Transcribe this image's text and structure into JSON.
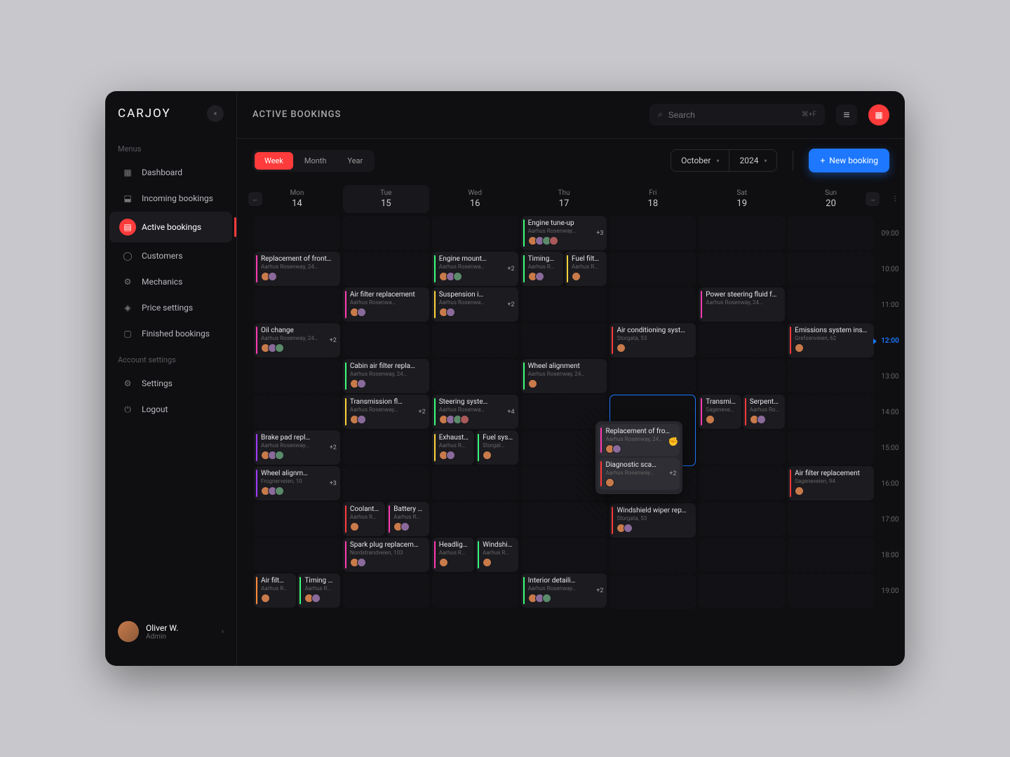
{
  "brand": "CARJOY",
  "page_title": "ACTIVE BOOKINGS",
  "search": {
    "placeholder": "Search",
    "shortcut": "⌘+F"
  },
  "sidebar": {
    "menus_label": "Menus",
    "account_label": "Account settings",
    "items": [
      {
        "label": "Dashboard",
        "icon": "grid"
      },
      {
        "label": "Incoming bookings",
        "icon": "inbox"
      },
      {
        "label": "Active bookings",
        "icon": "clipboard",
        "active": true
      },
      {
        "label": "Customers",
        "icon": "user"
      },
      {
        "label": "Mechanics",
        "icon": "wrench"
      },
      {
        "label": "Price settings",
        "icon": "tag"
      },
      {
        "label": "Finished bookings",
        "icon": "box"
      }
    ],
    "account_items": [
      {
        "label": "Settings",
        "icon": "gear"
      },
      {
        "label": "Logout",
        "icon": "power"
      }
    ]
  },
  "user": {
    "name": "Oliver W.",
    "role": "Admin"
  },
  "view_tabs": [
    "Week",
    "Month",
    "Year"
  ],
  "active_view": "Week",
  "month": "October",
  "year": "2024",
  "new_booking_label": "New booking",
  "days": [
    {
      "dow": "Mon",
      "num": "14"
    },
    {
      "dow": "Tue",
      "num": "15",
      "today": true
    },
    {
      "dow": "Wed",
      "num": "16"
    },
    {
      "dow": "Thu",
      "num": "17"
    },
    {
      "dow": "Fri",
      "num": "18"
    },
    {
      "dow": "Sat",
      "num": "19"
    },
    {
      "dow": "Sun",
      "num": "20"
    }
  ],
  "times": [
    "09:00",
    "10:00",
    "11:00",
    "12:00",
    "13:00",
    "14:00",
    "15:00",
    "16:00",
    "17:00",
    "18:00",
    "19:00"
  ],
  "now_time": "12:00",
  "colors": {
    "pink": "#ff3bb1",
    "green": "#3bff7a",
    "yellow": "#ffd23b",
    "red": "#ff3b3b",
    "purple": "#a23bff",
    "blue": "#3b8bff",
    "orange": "#ff8b3b",
    "cyan": "#3be0ff"
  },
  "grid": [
    [
      null,
      null,
      null,
      {
        "events": [
          {
            "t": "Engine tune-up",
            "l": "Aarhus Rosenway…",
            "c": "green",
            "b": "+3",
            "av": 4
          }
        ]
      },
      null,
      null,
      null
    ],
    [
      {
        "events": [
          {
            "t": "Replacement of front…",
            "l": "Aarhus Rosenway, 24…",
            "c": "pink",
            "av": 2
          }
        ]
      },
      null,
      {
        "events": [
          {
            "t": "Engine mount…",
            "l": "Aarhus Rosenwa…",
            "c": "green",
            "b": "+2",
            "av": 3
          }
        ]
      },
      {
        "events": [
          {
            "t": "Timing…",
            "l": "Aarhus R…",
            "c": "green",
            "av": 2
          },
          {
            "t": "Fuel filt…",
            "l": "Aarhus R…",
            "c": "yellow",
            "av": 1
          }
        ]
      },
      null,
      null,
      null
    ],
    [
      null,
      {
        "events": [
          {
            "t": "Air filter replacement",
            "l": "Aarhus Rosenwa…",
            "c": "pink",
            "av": 2
          }
        ]
      },
      {
        "events": [
          {
            "t": "Suspension i…",
            "l": "Aarhus Rosenwa…",
            "c": "yellow",
            "b": "+2",
            "av": 2
          }
        ]
      },
      null,
      null,
      {
        "events": [
          {
            "t": "Power steering fluid f…",
            "l": "Aarhus Rosenway, 24…",
            "c": "pink",
            "av": 0
          }
        ]
      },
      null
    ],
    [
      {
        "events": [
          {
            "t": "Oil change",
            "l": "Aarhus Rosenway, 24…",
            "c": "pink",
            "b": "+2",
            "av": 3
          }
        ]
      },
      null,
      null,
      null,
      {
        "events": [
          {
            "t": "Air conditioning syst…",
            "l": "Storgata, 53",
            "c": "red",
            "av": 1
          }
        ]
      },
      null,
      {
        "events": [
          {
            "t": "Emissions system ins…",
            "l": "Grefsenveien, 62",
            "c": "red",
            "av": 1
          }
        ]
      }
    ],
    [
      null,
      {
        "events": [
          {
            "t": "Cabin air filter repla…",
            "l": "Aarhus Rosenway, 24…",
            "c": "green",
            "av": 2
          }
        ]
      },
      null,
      {
        "events": [
          {
            "t": "Wheel alignment",
            "l": "Aarhus Rosenway, 24…",
            "c": "green",
            "av": 1
          }
        ]
      },
      null,
      null,
      null
    ],
    [
      null,
      {
        "events": [
          {
            "t": "Transmission fl…",
            "l": "Aarhus Rosenway…",
            "c": "yellow",
            "b": "+2",
            "av": 2
          }
        ]
      },
      {
        "events": [
          {
            "t": "Steering syste…",
            "l": "Aarhus Rosenwa…",
            "c": "green",
            "b": "+4",
            "av": 4
          }
        ]
      },
      null,
      {
        "drag": true
      },
      {
        "events": [
          {
            "t": "Transmi…",
            "l": "Sageneve…",
            "c": "pink",
            "av": 1
          },
          {
            "t": "Serpenti…",
            "l": "Aarhus Ro…",
            "c": "red",
            "av": 2
          }
        ]
      },
      null
    ],
    [
      {
        "events": [
          {
            "t": "Brake pad repl…",
            "l": "Aarhus Rosenway…",
            "c": "purple",
            "b": "+2",
            "av": 3
          }
        ]
      },
      null,
      {
        "events": [
          {
            "t": "Exhaust…",
            "l": "Aarhus R…",
            "c": "yellow",
            "av": 2
          },
          {
            "t": "Fuel sys…",
            "l": "Storgat…",
            "c": "green",
            "av": 1
          }
        ]
      },
      null,
      null,
      null,
      null
    ],
    [
      {
        "events": [
          {
            "t": "Wheel alignm…",
            "l": "Frognerveien, 10",
            "c": "purple",
            "b": "+3",
            "av": 3
          }
        ]
      },
      null,
      null,
      null,
      null,
      null,
      {
        "events": [
          {
            "t": "Air filter replacement",
            "l": "Sageneveien, 94",
            "c": "red",
            "av": 1
          }
        ]
      }
    ],
    [
      null,
      {
        "events": [
          {
            "t": "Coolant…",
            "l": "Aarhus R…",
            "c": "red",
            "av": 1
          },
          {
            "t": "Battery r…",
            "l": "Aarhus R…",
            "c": "pink",
            "av": 2
          }
        ]
      },
      null,
      null,
      {
        "events": [
          {
            "t": "Windshield wiper rep…",
            "l": "Storgata, 53",
            "c": "red",
            "av": 2
          }
        ]
      },
      null,
      null
    ],
    [
      null,
      {
        "events": [
          {
            "t": "Spark plug replacem…",
            "l": "Nordstrandveien, 103",
            "c": "pink",
            "av": 2
          }
        ]
      },
      {
        "events": [
          {
            "t": "Headlig…",
            "l": "Aarhus R…",
            "c": "pink",
            "av": 1
          },
          {
            "t": "Windshi…",
            "l": "Aarhus R…",
            "c": "green",
            "av": 1
          }
        ]
      },
      null,
      null,
      null,
      null
    ],
    [
      {
        "events": [
          {
            "t": "Air filt…",
            "l": "Aarhus R…",
            "c": "orange",
            "av": 1
          },
          {
            "t": "Timing b…",
            "l": "Aarhus R…",
            "c": "green",
            "av": 2
          }
        ]
      },
      null,
      null,
      {
        "events": [
          {
            "t": "Interior detaili…",
            "l": "Aarhus Rosenway…",
            "c": "green",
            "b": "+2",
            "av": 3
          }
        ]
      },
      null,
      null,
      null
    ]
  ],
  "drag_events": [
    {
      "t": "Replacement of fro…",
      "l": "Aarhus Rosenway, 24…",
      "c": "pink",
      "av": 2
    },
    {
      "t": "Diagnostic sca…",
      "l": "Aarhus Rosenway…",
      "c": "red",
      "b": "+2",
      "av": 1
    }
  ]
}
